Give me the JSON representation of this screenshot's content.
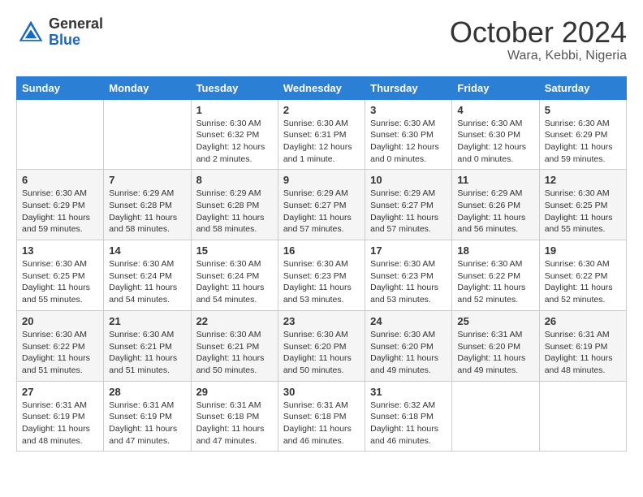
{
  "header": {
    "logo_general": "General",
    "logo_blue": "Blue",
    "month_title": "October 2024",
    "subtitle": "Wara, Kebbi, Nigeria"
  },
  "days_of_week": [
    "Sunday",
    "Monday",
    "Tuesday",
    "Wednesday",
    "Thursday",
    "Friday",
    "Saturday"
  ],
  "weeks": [
    [
      {
        "num": "",
        "sunrise": "",
        "sunset": "",
        "daylight": ""
      },
      {
        "num": "",
        "sunrise": "",
        "sunset": "",
        "daylight": ""
      },
      {
        "num": "1",
        "sunrise": "Sunrise: 6:30 AM",
        "sunset": "Sunset: 6:32 PM",
        "daylight": "Daylight: 12 hours and 2 minutes."
      },
      {
        "num": "2",
        "sunrise": "Sunrise: 6:30 AM",
        "sunset": "Sunset: 6:31 PM",
        "daylight": "Daylight: 12 hours and 1 minute."
      },
      {
        "num": "3",
        "sunrise": "Sunrise: 6:30 AM",
        "sunset": "Sunset: 6:30 PM",
        "daylight": "Daylight: 12 hours and 0 minutes."
      },
      {
        "num": "4",
        "sunrise": "Sunrise: 6:30 AM",
        "sunset": "Sunset: 6:30 PM",
        "daylight": "Daylight: 12 hours and 0 minutes."
      },
      {
        "num": "5",
        "sunrise": "Sunrise: 6:30 AM",
        "sunset": "Sunset: 6:29 PM",
        "daylight": "Daylight: 11 hours and 59 minutes."
      }
    ],
    [
      {
        "num": "6",
        "sunrise": "Sunrise: 6:30 AM",
        "sunset": "Sunset: 6:29 PM",
        "daylight": "Daylight: 11 hours and 59 minutes."
      },
      {
        "num": "7",
        "sunrise": "Sunrise: 6:29 AM",
        "sunset": "Sunset: 6:28 PM",
        "daylight": "Daylight: 11 hours and 58 minutes."
      },
      {
        "num": "8",
        "sunrise": "Sunrise: 6:29 AM",
        "sunset": "Sunset: 6:28 PM",
        "daylight": "Daylight: 11 hours and 58 minutes."
      },
      {
        "num": "9",
        "sunrise": "Sunrise: 6:29 AM",
        "sunset": "Sunset: 6:27 PM",
        "daylight": "Daylight: 11 hours and 57 minutes."
      },
      {
        "num": "10",
        "sunrise": "Sunrise: 6:29 AM",
        "sunset": "Sunset: 6:27 PM",
        "daylight": "Daylight: 11 hours and 57 minutes."
      },
      {
        "num": "11",
        "sunrise": "Sunrise: 6:29 AM",
        "sunset": "Sunset: 6:26 PM",
        "daylight": "Daylight: 11 hours and 56 minutes."
      },
      {
        "num": "12",
        "sunrise": "Sunrise: 6:30 AM",
        "sunset": "Sunset: 6:25 PM",
        "daylight": "Daylight: 11 hours and 55 minutes."
      }
    ],
    [
      {
        "num": "13",
        "sunrise": "Sunrise: 6:30 AM",
        "sunset": "Sunset: 6:25 PM",
        "daylight": "Daylight: 11 hours and 55 minutes."
      },
      {
        "num": "14",
        "sunrise": "Sunrise: 6:30 AM",
        "sunset": "Sunset: 6:24 PM",
        "daylight": "Daylight: 11 hours and 54 minutes."
      },
      {
        "num": "15",
        "sunrise": "Sunrise: 6:30 AM",
        "sunset": "Sunset: 6:24 PM",
        "daylight": "Daylight: 11 hours and 54 minutes."
      },
      {
        "num": "16",
        "sunrise": "Sunrise: 6:30 AM",
        "sunset": "Sunset: 6:23 PM",
        "daylight": "Daylight: 11 hours and 53 minutes."
      },
      {
        "num": "17",
        "sunrise": "Sunrise: 6:30 AM",
        "sunset": "Sunset: 6:23 PM",
        "daylight": "Daylight: 11 hours and 53 minutes."
      },
      {
        "num": "18",
        "sunrise": "Sunrise: 6:30 AM",
        "sunset": "Sunset: 6:22 PM",
        "daylight": "Daylight: 11 hours and 52 minutes."
      },
      {
        "num": "19",
        "sunrise": "Sunrise: 6:30 AM",
        "sunset": "Sunset: 6:22 PM",
        "daylight": "Daylight: 11 hours and 52 minutes."
      }
    ],
    [
      {
        "num": "20",
        "sunrise": "Sunrise: 6:30 AM",
        "sunset": "Sunset: 6:22 PM",
        "daylight": "Daylight: 11 hours and 51 minutes."
      },
      {
        "num": "21",
        "sunrise": "Sunrise: 6:30 AM",
        "sunset": "Sunset: 6:21 PM",
        "daylight": "Daylight: 11 hours and 51 minutes."
      },
      {
        "num": "22",
        "sunrise": "Sunrise: 6:30 AM",
        "sunset": "Sunset: 6:21 PM",
        "daylight": "Daylight: 11 hours and 50 minutes."
      },
      {
        "num": "23",
        "sunrise": "Sunrise: 6:30 AM",
        "sunset": "Sunset: 6:20 PM",
        "daylight": "Daylight: 11 hours and 50 minutes."
      },
      {
        "num": "24",
        "sunrise": "Sunrise: 6:30 AM",
        "sunset": "Sunset: 6:20 PM",
        "daylight": "Daylight: 11 hours and 49 minutes."
      },
      {
        "num": "25",
        "sunrise": "Sunrise: 6:31 AM",
        "sunset": "Sunset: 6:20 PM",
        "daylight": "Daylight: 11 hours and 49 minutes."
      },
      {
        "num": "26",
        "sunrise": "Sunrise: 6:31 AM",
        "sunset": "Sunset: 6:19 PM",
        "daylight": "Daylight: 11 hours and 48 minutes."
      }
    ],
    [
      {
        "num": "27",
        "sunrise": "Sunrise: 6:31 AM",
        "sunset": "Sunset: 6:19 PM",
        "daylight": "Daylight: 11 hours and 48 minutes."
      },
      {
        "num": "28",
        "sunrise": "Sunrise: 6:31 AM",
        "sunset": "Sunset: 6:19 PM",
        "daylight": "Daylight: 11 hours and 47 minutes."
      },
      {
        "num": "29",
        "sunrise": "Sunrise: 6:31 AM",
        "sunset": "Sunset: 6:18 PM",
        "daylight": "Daylight: 11 hours and 47 minutes."
      },
      {
        "num": "30",
        "sunrise": "Sunrise: 6:31 AM",
        "sunset": "Sunset: 6:18 PM",
        "daylight": "Daylight: 11 hours and 46 minutes."
      },
      {
        "num": "31",
        "sunrise": "Sunrise: 6:32 AM",
        "sunset": "Sunset: 6:18 PM",
        "daylight": "Daylight: 11 hours and 46 minutes."
      },
      {
        "num": "",
        "sunrise": "",
        "sunset": "",
        "daylight": ""
      },
      {
        "num": "",
        "sunrise": "",
        "sunset": "",
        "daylight": ""
      }
    ]
  ]
}
